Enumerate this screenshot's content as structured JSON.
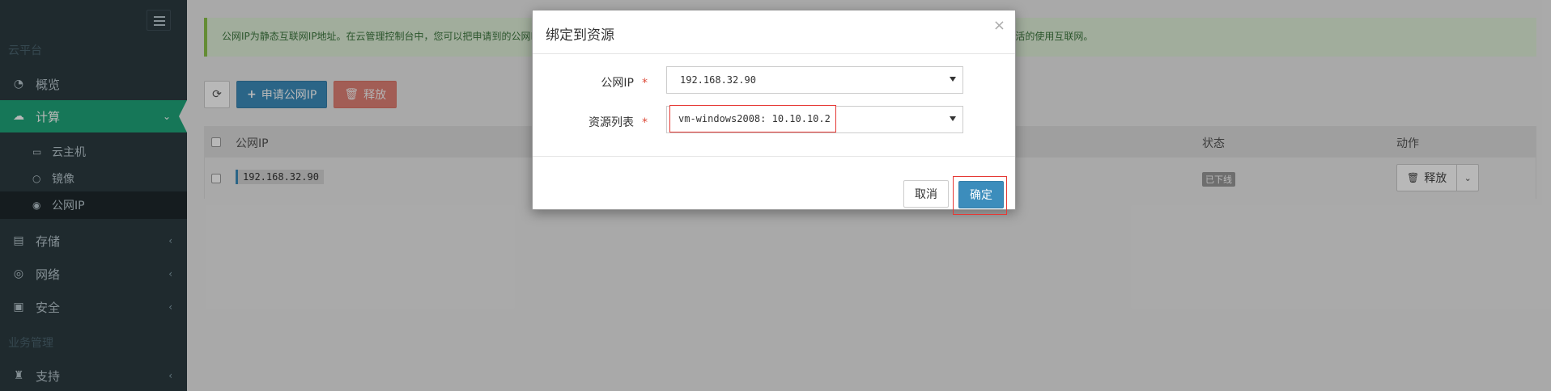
{
  "sidebar": {
    "section_cloud": "云平台",
    "section_business": "业务管理",
    "items": [
      {
        "label": "概览",
        "icon": "dashboard-icon"
      },
      {
        "label": "计算",
        "icon": "cloud-icon"
      },
      {
        "label": "存储",
        "icon": "database-icon"
      },
      {
        "label": "网络",
        "icon": "globe-icon"
      },
      {
        "label": "安全",
        "icon": "shield-icon"
      },
      {
        "label": "支持",
        "icon": "user-icon"
      }
    ],
    "sub_items": [
      {
        "label": "云主机",
        "icon": "monitor-icon"
      },
      {
        "label": "镜像",
        "icon": "circle-icon"
      },
      {
        "label": "公网IP",
        "icon": "globe-icon"
      }
    ]
  },
  "alert": {
    "text": "公网IP为静态互联网IP地址。在云管理控制台中，您可以把申请到的公网IP绑定到云主机或负载均衡上，这样，云主机或负载均衡就可以直接访问互联网，也可以被外部访问，让您更加灵活的使用互联网。"
  },
  "toolbar": {
    "apply_label": "申请公网IP",
    "release_label": "释放"
  },
  "table": {
    "headers": {
      "ip": "公网IP",
      "status": "状态",
      "action": "动作"
    },
    "rows": [
      {
        "ip": "192.168.32.90",
        "status": "已下线",
        "action": "释放"
      }
    ]
  },
  "modal": {
    "title": "绑定到资源",
    "close": "×",
    "ip_label": "公网IP",
    "resource_label": "资源列表",
    "required_mark": "*",
    "ip_value": "192.168.32.90",
    "resource_value": "vm-windows2008: 10.10.10.2",
    "cancel_label": "取消",
    "ok_label": "确定"
  },
  "colors": {
    "sidebar_bg": "#2c3b41",
    "active_green": "#1fa67a",
    "primary_blue": "#3c8dbc",
    "danger_red": "#dd4b39",
    "highlight_red": "#e53935"
  }
}
